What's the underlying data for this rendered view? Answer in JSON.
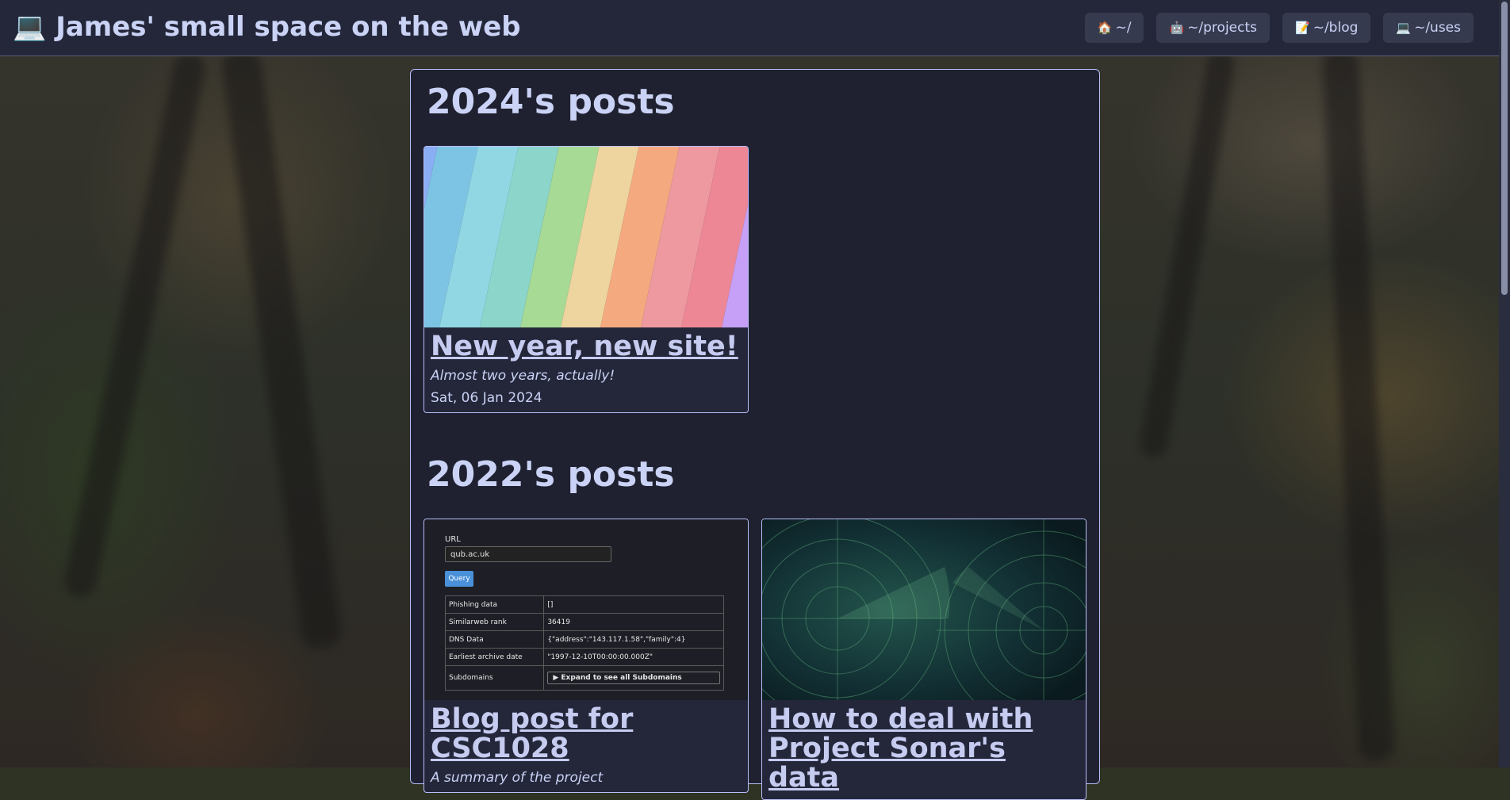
{
  "site": {
    "title_icon": "💻",
    "title": "James' small space on the web"
  },
  "nav": [
    {
      "icon": "🏠",
      "label": "~/"
    },
    {
      "icon": "🤖",
      "label": "~/projects"
    },
    {
      "icon": "📝",
      "label": "~/blog"
    },
    {
      "icon": "💻",
      "label": "~/uses"
    }
  ],
  "sections": [
    {
      "heading": "2024's posts",
      "posts": [
        {
          "title": "New year, new site!",
          "subtitle": "Almost two years, actually!",
          "date": "Sat, 06 Jan 2024",
          "thumbnail": "rainbow-stripes"
        }
      ]
    },
    {
      "heading": "2022's posts",
      "posts": [
        {
          "title": "Blog post for CSC1028",
          "subtitle": "A summary of the project",
          "thumbnail": "query-tool-screenshot"
        },
        {
          "title": "How to deal with Project Sonar's data",
          "thumbnail": "radar-image"
        }
      ]
    }
  ],
  "csc_screenshot": {
    "url_label": "URL",
    "url_value": "qub.ac.uk",
    "query_button": "Query",
    "rows": [
      [
        "Phishing data",
        "[]"
      ],
      [
        "Similarweb rank",
        "36419"
      ],
      [
        "DNS Data",
        "{\"address\":\"143.117.1.58\",\"family\":4}"
      ],
      [
        "Earliest archive date",
        "\"1997-12-10T00:00:00.000Z\""
      ],
      [
        "Subdomains",
        "▶ Expand to see all Subdomains"
      ]
    ]
  },
  "colors": {
    "accent": "#b7bdf8",
    "header_bg": "#24273a",
    "panel_bg": "#1f2130",
    "text": "#cad3f5",
    "rainbow": [
      "#8aadf4",
      "#7dc4e4",
      "#91d7e3",
      "#8bd5ca",
      "#a6da95",
      "#eed49f",
      "#f5a97f",
      "#ee99a0",
      "#ed8796",
      "#c6a0f6",
      "#f5bde6"
    ]
  }
}
